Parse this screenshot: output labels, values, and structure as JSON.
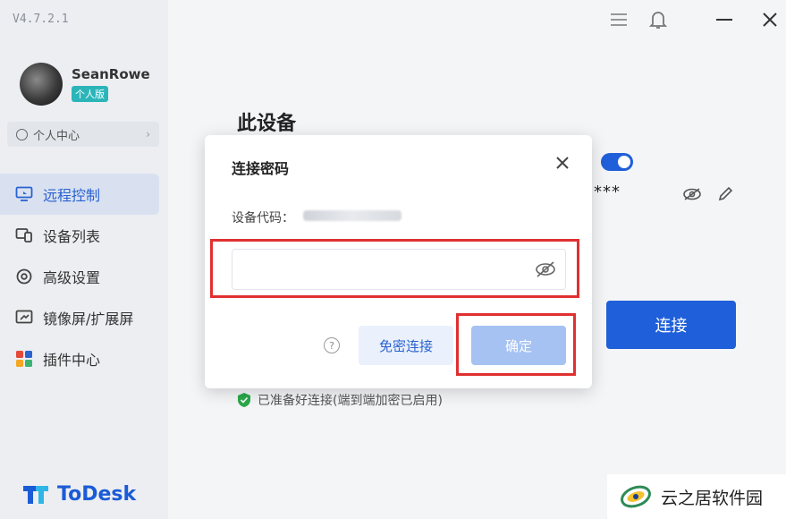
{
  "app": {
    "version": "V4.7.2.1",
    "brand": "ToDesk"
  },
  "user": {
    "name": "SeanRowe",
    "plan_badge": "个人版",
    "personal_center_label": "个人中心"
  },
  "nav": {
    "items": [
      {
        "label": "远程控制",
        "icon": "remote-control-icon",
        "active": true
      },
      {
        "label": "设备列表",
        "icon": "device-list-icon",
        "active": false
      },
      {
        "label": "高级设置",
        "icon": "settings-icon",
        "active": false
      },
      {
        "label": "镜像屏/扩展屏",
        "icon": "mirror-screen-icon",
        "active": false
      },
      {
        "label": "插件中心",
        "icon": "plugin-icon",
        "active": false
      }
    ]
  },
  "main": {
    "section_title": "此设备",
    "password_mask": "***",
    "connect_label": "连接",
    "status_text": "已准备好连接(端到端加密已启用)"
  },
  "dialog": {
    "title": "连接密码",
    "device_code_label": "设备代码：",
    "password_value": "",
    "free_connect_label": "免密连接",
    "confirm_label": "确定"
  },
  "watermark": {
    "text": "云之居软件园"
  },
  "colors": {
    "accent": "#1f5fd9",
    "highlight": "#e03030",
    "sidebar_bg": "#eceef2",
    "badge": "#2bb5b9"
  }
}
